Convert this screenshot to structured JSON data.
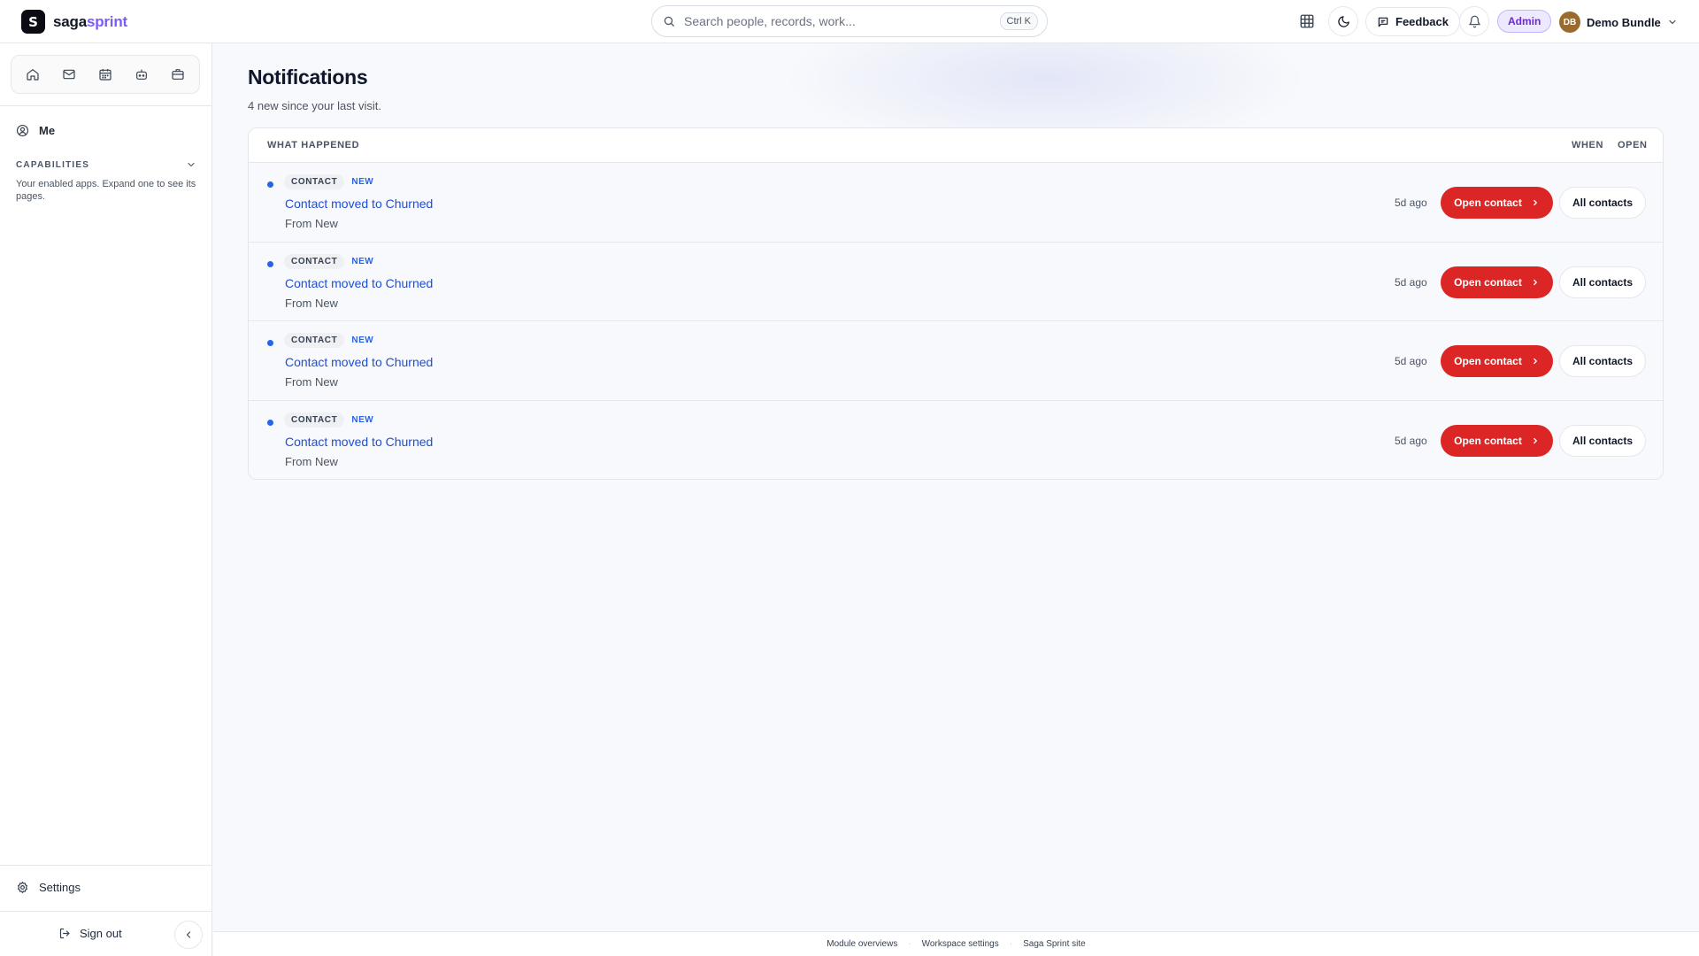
{
  "brand": {
    "name_part1": "saga",
    "name_part2": "sprint",
    "logo_letter": "S"
  },
  "search": {
    "placeholder": "Search people, records, work...",
    "shortcut": "Ctrl K"
  },
  "header": {
    "feedback_label": "Feedback",
    "role_badge": "Admin",
    "user_initials": "DB",
    "user_name": "Demo Bundle"
  },
  "sidebar": {
    "apps": [
      "home-icon",
      "mail-icon",
      "calendar-icon",
      "bot-icon",
      "briefcase-icon"
    ],
    "me_label": "Me",
    "capabilities_title": "CAPABILITIES",
    "capabilities_desc": "Your enabled apps. Expand one to see its pages.",
    "settings_label": "Settings",
    "signout_label": "Sign out"
  },
  "page": {
    "title": "Notifications",
    "subtitle": "4 new since your last visit."
  },
  "table": {
    "col_what": "WHAT HAPPENED",
    "col_when": "WHEN",
    "col_open": "OPEN",
    "rows": [
      {
        "type": "CONTACT",
        "status": "NEW",
        "title": "Contact moved to Churned",
        "detail": "From New",
        "when": "5d ago",
        "open_label": "Open contact",
        "all_label": "All contacts",
        "unread": true
      },
      {
        "type": "CONTACT",
        "status": "NEW",
        "title": "Contact moved to Churned",
        "detail": "From New",
        "when": "5d ago",
        "open_label": "Open contact",
        "all_label": "All contacts",
        "unread": true
      },
      {
        "type": "CONTACT",
        "status": "NEW",
        "title": "Contact moved to Churned",
        "detail": "From New",
        "when": "5d ago",
        "open_label": "Open contact",
        "all_label": "All contacts",
        "unread": true
      },
      {
        "type": "CONTACT",
        "status": "NEW",
        "title": "Contact moved to Churned",
        "detail": "From New",
        "when": "5d ago",
        "open_label": "Open contact",
        "all_label": "All contacts",
        "unread": true
      }
    ]
  },
  "footer": {
    "links": [
      "Module overviews",
      "Workspace settings",
      "Saga Sprint site"
    ],
    "separator": "·"
  },
  "colors": {
    "accent_red": "#dc2626",
    "link_blue": "#1d4ed8",
    "brand_purple": "#7c5cf6",
    "unread_dot": "#2563eb"
  }
}
